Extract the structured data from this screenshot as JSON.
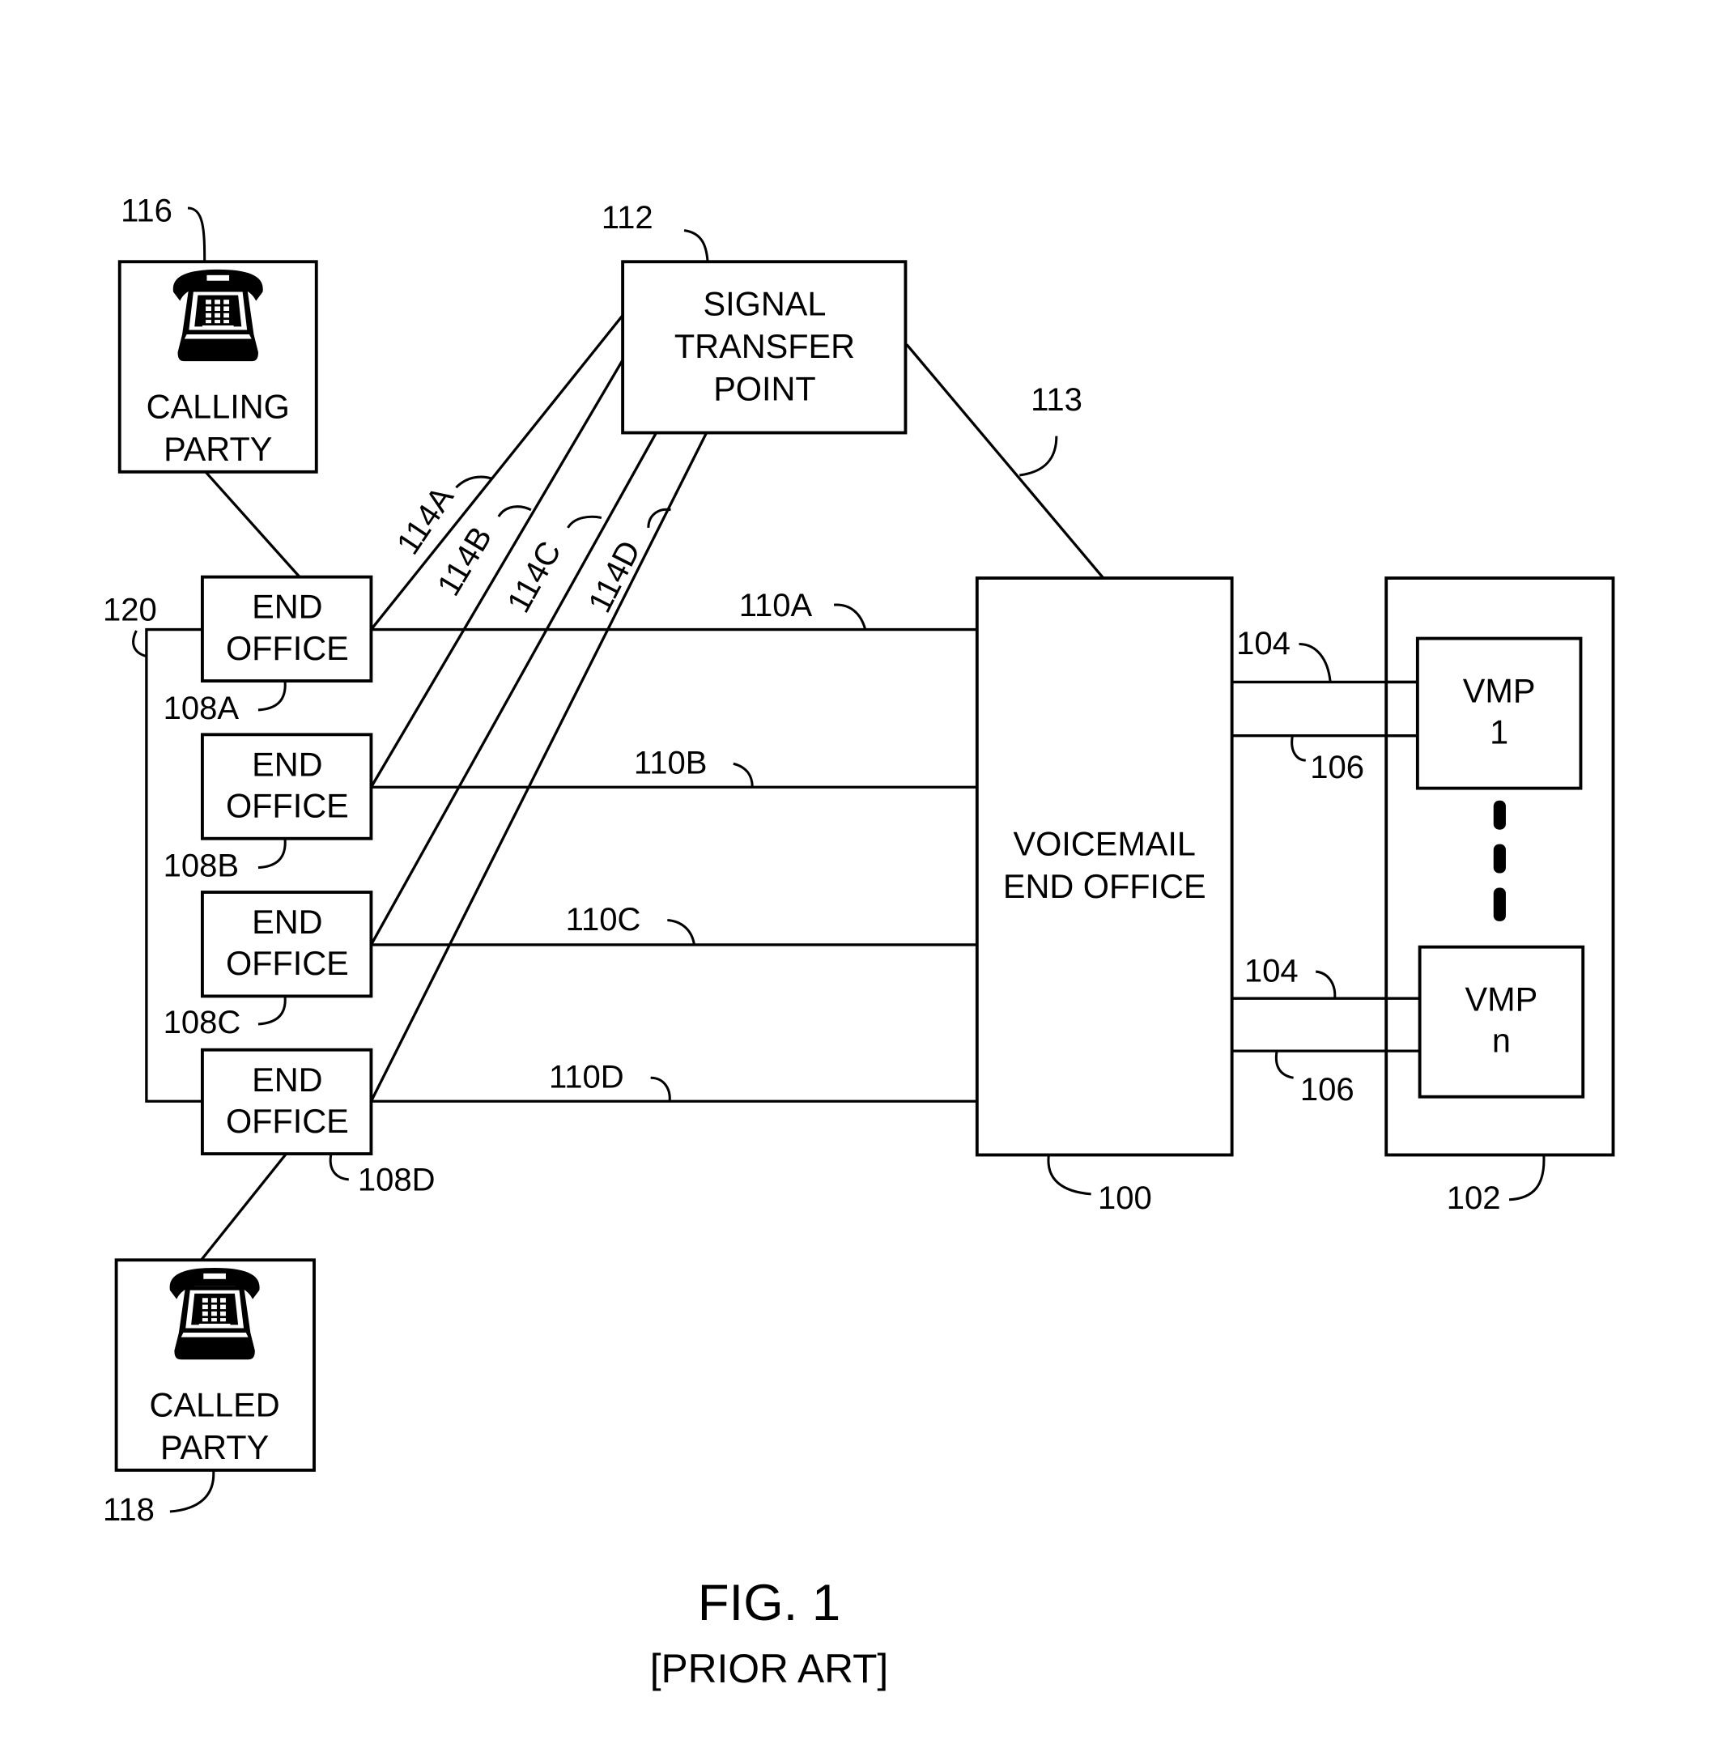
{
  "figure": {
    "title": "FIG. 1",
    "subtitle": "[PRIOR ART]"
  },
  "nodes": {
    "calling_party": {
      "lines": [
        "CALLING",
        "PARTY"
      ],
      "ref": "116",
      "icon": "telephone-icon"
    },
    "called_party": {
      "lines": [
        "CALLED",
        "PARTY"
      ],
      "ref": "118",
      "icon": "telephone-icon"
    },
    "stp": {
      "lines": [
        "SIGNAL",
        "TRANSFER",
        "POINT"
      ],
      "ref": "112"
    },
    "end_offices": [
      {
        "lines": [
          "END",
          "OFFICE"
        ],
        "ref": "108A"
      },
      {
        "lines": [
          "END",
          "OFFICE"
        ],
        "ref": "108B"
      },
      {
        "lines": [
          "END",
          "OFFICE"
        ],
        "ref": "108C"
      },
      {
        "lines": [
          "END",
          "OFFICE"
        ],
        "ref": "108D"
      }
    ],
    "end_office_group_ref": "120",
    "voicemail_eo": {
      "lines": [
        "VOICEMAIL",
        "END OFFICE"
      ],
      "ref": "100"
    },
    "vmp_container_ref": "102",
    "vmps": [
      {
        "lines": [
          "VMP",
          "1"
        ]
      },
      {
        "lines": [
          "VMP",
          "n"
        ]
      }
    ]
  },
  "links": {
    "stp_to_veo": "113",
    "signaling": [
      "114A",
      "114B",
      "114C",
      "114D"
    ],
    "trunks": [
      "110A",
      "110B",
      "110C",
      "110D"
    ],
    "vmp_links": [
      {
        "upper": "104",
        "lower": "106"
      },
      {
        "upper": "104",
        "lower": "106"
      }
    ]
  }
}
